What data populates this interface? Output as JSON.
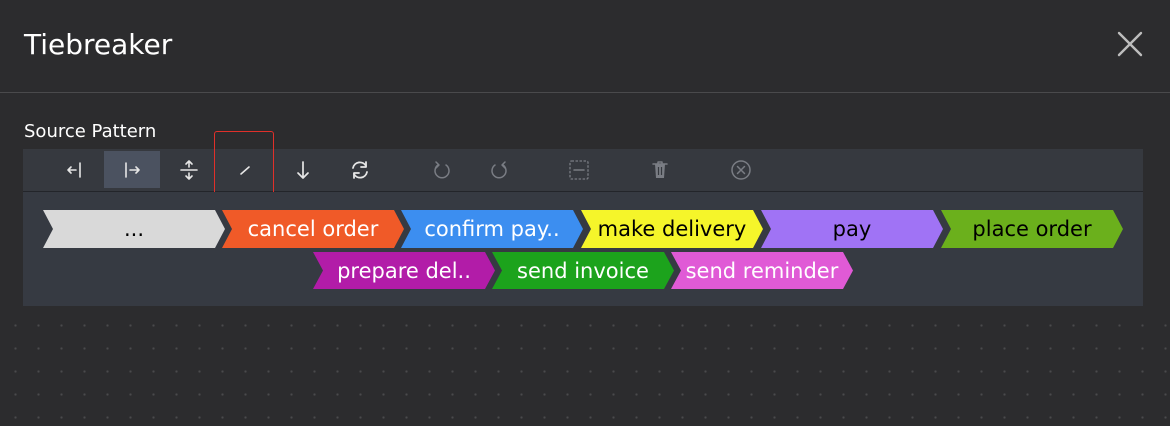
{
  "dialog": {
    "title": "Tiebreaker",
    "close_icon": "close-icon"
  },
  "source_pattern": {
    "label": "Source Pattern"
  },
  "toolbar": {
    "buttons": [
      {
        "name": "align-left-icon",
        "state": "enabled"
      },
      {
        "name": "align-right-icon",
        "state": "active"
      },
      {
        "name": "expand-vertical-icon",
        "state": "enabled"
      },
      {
        "name": "edit-line-icon",
        "state": "enabled",
        "highlighted": true
      },
      {
        "name": "arrow-down-icon",
        "state": "enabled"
      },
      {
        "name": "refresh-icon",
        "state": "enabled"
      },
      {
        "name": "undo-icon",
        "state": "disabled"
      },
      {
        "name": "redo-icon",
        "state": "disabled"
      },
      {
        "name": "collapse-icon",
        "state": "disabled"
      },
      {
        "name": "trash-icon",
        "state": "disabled"
      },
      {
        "name": "clear-icon",
        "state": "disabled"
      }
    ],
    "highlight_color": "#e0302a"
  },
  "pattern": {
    "activities": [
      {
        "label": "...",
        "color": "#d9d9d9",
        "text_color": "#000000"
      },
      {
        "label": "cancel order",
        "color": "#f05a28",
        "text_color": "#ffffff"
      },
      {
        "label": "confirm pay..",
        "color": "#3c8ef0",
        "text_color": "#ffffff"
      },
      {
        "label": "make delivery",
        "color": "#f5f52a",
        "text_color": "#000000"
      },
      {
        "label": "pay",
        "color": "#a073f5",
        "text_color": "#000000"
      },
      {
        "label": "place order",
        "color": "#6bb01c",
        "text_color": "#000000"
      },
      {
        "label": "prepare del..",
        "color": "#b21ca8",
        "text_color": "#ffffff"
      },
      {
        "label": "send invoice",
        "color": "#1ca31c",
        "text_color": "#ffffff"
      },
      {
        "label": "send reminder",
        "color": "#e05ad6",
        "text_color": "#ffffff"
      }
    ]
  }
}
